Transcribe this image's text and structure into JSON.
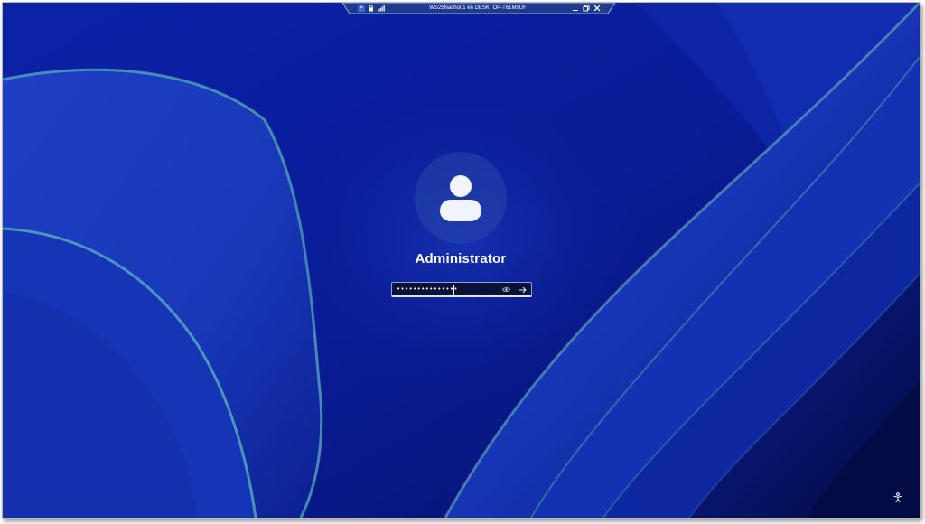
{
  "rdp_bar": {
    "title": "WS25Nacho01 en DESKTOP-T61M9UF",
    "icons": [
      "pin-icon",
      "lock-icon",
      "signal-icon"
    ],
    "buttons": [
      "minimize-icon",
      "restore-icon",
      "close-icon"
    ]
  },
  "login": {
    "username": "Administrator",
    "password_value": "•••••••••••••••",
    "reveal_icon": "eye-icon",
    "submit_icon": "arrow-right-icon"
  },
  "accessibility": {
    "icon": "accessibility-icon"
  },
  "colors": {
    "wallpaper_dark": "#071a8c",
    "wallpaper_light": "#2a4bd0",
    "wallpaper_edge": "#5d9fb6",
    "text": "#ffffff"
  }
}
